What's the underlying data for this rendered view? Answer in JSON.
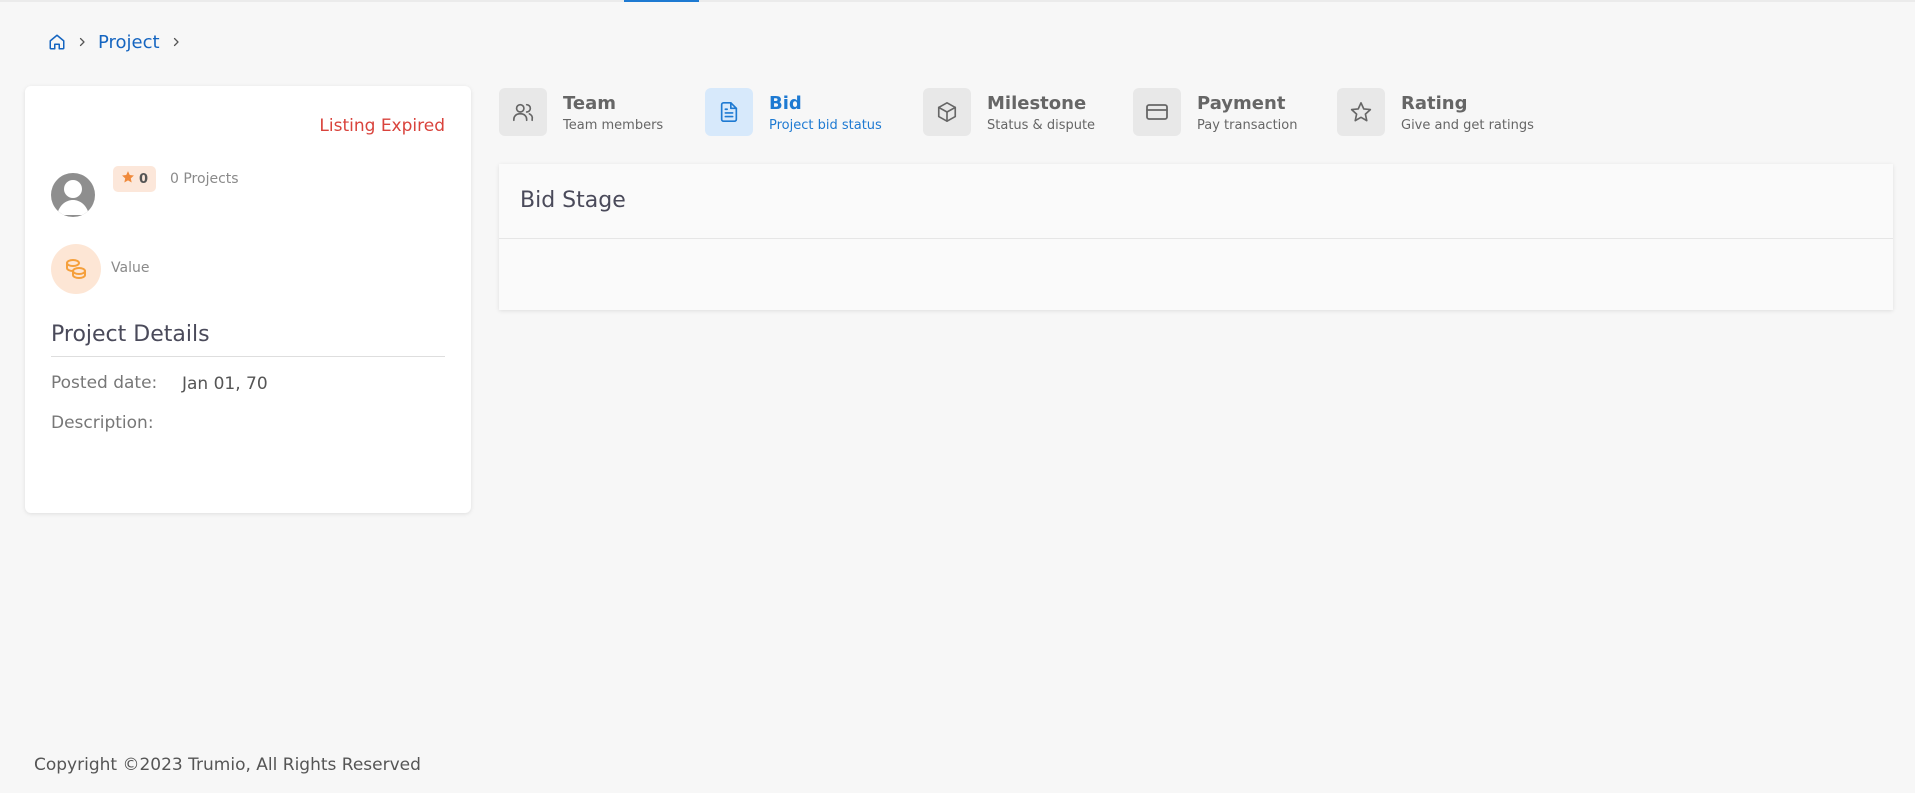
{
  "breadcrumb": {
    "home_icon": "home-icon",
    "items": [
      "Project"
    ]
  },
  "project_card": {
    "status": "Listing Expired",
    "status_color": "#d9433c",
    "rating": "0",
    "projects_count": "0 Projects",
    "value_label": "Value",
    "details_title": "Project Details",
    "posted_date_label": "Posted date:",
    "posted_date_value": "Jan 01, 70",
    "description_label": "Description:"
  },
  "tabs": [
    {
      "title": "Team",
      "subtitle": "Team members",
      "icon": "users-icon",
      "active": false
    },
    {
      "title": "Bid",
      "subtitle": "Project bid status",
      "icon": "document-icon",
      "active": true
    },
    {
      "title": "Milestone",
      "subtitle": "Status & dispute",
      "icon": "box-icon",
      "active": false
    },
    {
      "title": "Payment",
      "subtitle": "Pay transaction",
      "icon": "credit-card-icon",
      "active": false
    },
    {
      "title": "Rating",
      "subtitle": "Give and get ratings",
      "icon": "star-icon",
      "active": false
    }
  ],
  "bid_panel": {
    "title": "Bid Stage"
  },
  "footer": {
    "copyright": "Copyright ©2023 Trumio, All Rights Reserved"
  },
  "colors": {
    "accent": "#1e7ad2",
    "link": "#1565c0",
    "rating_badge_bg": "#fce7da",
    "value_icon_bg": "#fde6d5",
    "value_icon_fg": "#f5a03c"
  }
}
